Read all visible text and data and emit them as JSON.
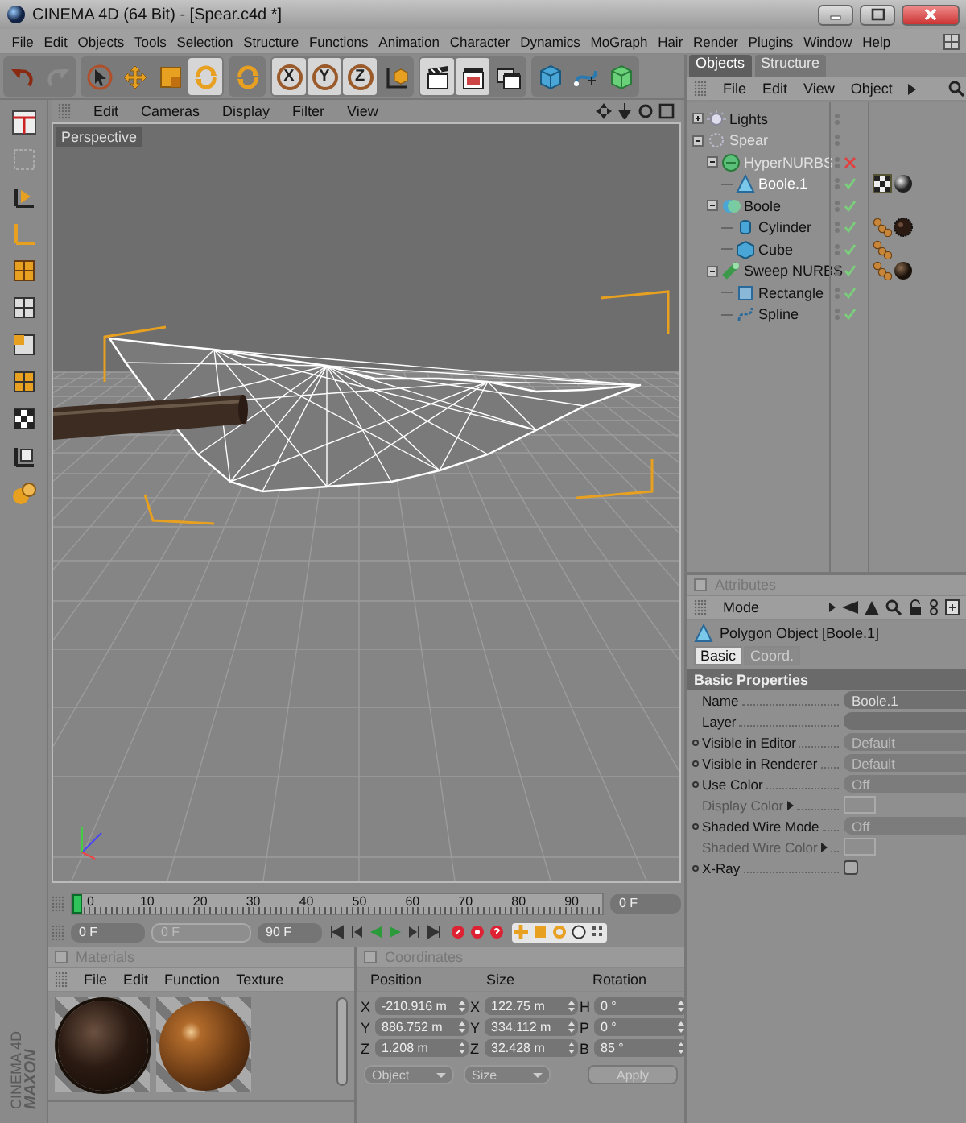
{
  "window": {
    "title": "CINEMA 4D (64 Bit) - [Spear.c4d *]"
  },
  "menu": [
    "File",
    "Edit",
    "Objects",
    "Tools",
    "Selection",
    "Structure",
    "Functions",
    "Animation",
    "Character",
    "Dynamics",
    "MoGraph",
    "Hair",
    "Render",
    "Plugins",
    "Window",
    "Help"
  ],
  "toolbar": [
    [
      {
        "kind": "undo",
        "selected": false,
        "disabled": false
      },
      {
        "kind": "redo",
        "selected": false,
        "disabled": true
      }
    ],
    [
      {
        "kind": "select",
        "selected": false,
        "disabled": false
      },
      {
        "kind": "move",
        "selected": false,
        "disabled": false
      },
      {
        "kind": "scale",
        "selected": false,
        "disabled": false
      },
      {
        "kind": "rotate",
        "selected": true,
        "disabled": false
      }
    ],
    [
      {
        "kind": "recent",
        "selected": false,
        "disabled": false
      }
    ],
    [
      {
        "kind": "axis",
        "label": "X",
        "selected": true,
        "disabled": false
      },
      {
        "kind": "axis",
        "label": "Y",
        "selected": true,
        "disabled": false
      },
      {
        "kind": "axis",
        "label": "Z",
        "selected": true,
        "disabled": false
      },
      {
        "kind": "coords",
        "selected": false,
        "disabled": false
      }
    ],
    [
      {
        "kind": "render-view",
        "selected": true,
        "disabled": false
      },
      {
        "kind": "render-picture",
        "selected": true,
        "disabled": false
      },
      {
        "kind": "render-settings",
        "selected": false,
        "disabled": false
      }
    ],
    [
      {
        "kind": "cube",
        "selected": false,
        "disabled": false
      },
      {
        "kind": "spline",
        "selected": false,
        "disabled": false
      },
      {
        "kind": "nurbs",
        "selected": false,
        "disabled": false
      }
    ]
  ],
  "viewport": {
    "menu": [
      "Edit",
      "Cameras",
      "Display",
      "Filter",
      "View"
    ],
    "camera": "Perspective"
  },
  "timeline": {
    "ticks": [
      "0",
      "10",
      "20",
      "30",
      "40",
      "50",
      "60",
      "70",
      "80",
      "90"
    ],
    "playhead": {
      "level": 0
    },
    "current_frame": "0 F",
    "start": "0 F",
    "preview": "0 F",
    "preview_disabled": true,
    "end": "90 F"
  },
  "materials": {
    "title": "Materials",
    "pinned": false,
    "menu": [
      "File",
      "Edit",
      "Function",
      "Texture"
    ],
    "swatches": [
      {
        "kind": "rough"
      },
      {
        "kind": "glossy"
      }
    ]
  },
  "coordinates": {
    "title": "Coordinates",
    "pinned": false,
    "columns": [
      "Position",
      "Size",
      "Rotation"
    ],
    "rows": [
      {
        "cells": [
          {
            "axis": "X",
            "value": "-210.916 m"
          },
          {
            "axis": "X",
            "value": "122.75 m"
          },
          {
            "axis": "H",
            "value": "0 °"
          }
        ]
      },
      {
        "cells": [
          {
            "axis": "Y",
            "value": "886.752 m"
          },
          {
            "axis": "Y",
            "value": "334.112 m"
          },
          {
            "axis": "P",
            "value": "0 °"
          }
        ]
      },
      {
        "cells": [
          {
            "axis": "Z",
            "value": "1.208 m"
          },
          {
            "axis": "Z",
            "value": "32.428 m"
          },
          {
            "axis": "B",
            "value": "85 °"
          }
        ]
      }
    ],
    "mode": "Object",
    "size_mode": "Size",
    "apply": "Apply"
  },
  "logo": {
    "brand": "MAXON",
    "product": "CINEMA 4D"
  },
  "objects": {
    "tabs": [
      {
        "label": "Objects",
        "selected": true
      },
      {
        "label": "Structure",
        "selected": false
      }
    ],
    "menu": [
      "File",
      "Edit",
      "View",
      "Object"
    ],
    "tree": [
      {
        "name": "Lights",
        "kind": "light",
        "expanded": false,
        "selected": false,
        "dimmed": false
      },
      {
        "name": "Spear",
        "kind": "null",
        "expanded": true,
        "selected": false,
        "dimmed": true,
        "children": [
          {
            "name": "HyperNURBS",
            "kind": "hypernurbs",
            "expanded": true,
            "selected": false,
            "dimmed": true,
            "enabled": false,
            "children": [
              {
                "name": "Boole.1",
                "kind": "polygon",
                "selected": true,
                "dimmed": false,
                "enabled": true,
                "tags": [
                  {
                    "kind": "texture"
                  },
                  {
                    "kind": "material-grey"
                  }
                ]
              }
            ]
          },
          {
            "name": "Boole",
            "kind": "boole",
            "expanded": true,
            "selected": false,
            "dimmed": false,
            "enabled": true,
            "children": [
              {
                "name": "Cylinder",
                "kind": "cylinder",
                "selected": false,
                "dimmed": false,
                "enabled": true,
                "tags": [
                  {
                    "kind": "texture-coords"
                  },
                  {
                    "kind": "material-rough"
                  }
                ]
              },
              {
                "name": "Cube",
                "kind": "cube",
                "selected": false,
                "dimmed": false,
                "enabled": true,
                "tags": [
                  {
                    "kind": "texture-coords"
                  }
                ]
              }
            ]
          },
          {
            "name": "Sweep NURBS",
            "kind": "sweep",
            "expanded": true,
            "selected": false,
            "dimmed": false,
            "enabled": true,
            "tags": [
              {
                "kind": "texture-coords"
              },
              {
                "kind": "material-dark"
              }
            ],
            "children": [
              {
                "name": "Rectangle",
                "kind": "rectangle",
                "selected": false,
                "dimmed": false,
                "enabled": true
              },
              {
                "name": "Spline",
                "kind": "spline",
                "selected": false,
                "dimmed": false,
                "enabled": true
              }
            ]
          }
        ]
      }
    ]
  },
  "attributes": {
    "title": "Attributes",
    "pinned": false,
    "mode": "Mode",
    "object": "Polygon Object [Boole.1]",
    "tabs": [
      {
        "label": "Basic",
        "selected": true
      },
      {
        "label": "Coord.",
        "selected": false
      }
    ],
    "section": "Basic Properties",
    "fields": [
      {
        "label": "Name",
        "kind": "text",
        "value": "Boole.1",
        "animatable": false,
        "disabled": false
      },
      {
        "label": "Layer",
        "kind": "text",
        "animatable": false,
        "disabled": false
      },
      {
        "label": "Visible in Editor",
        "kind": "dropdown",
        "value": "Default",
        "animatable": true,
        "disabled": false
      },
      {
        "label": "Visible in Renderer",
        "kind": "dropdown",
        "value": "Default",
        "animatable": true,
        "disabled": false
      },
      {
        "label": "Use Color",
        "kind": "dropdown",
        "value": "Off",
        "animatable": true,
        "disabled": false
      },
      {
        "label": "Display Color",
        "kind": "color",
        "animatable": false,
        "disabled": true
      },
      {
        "label": "Shaded Wire Mode",
        "kind": "dropdown",
        "value": "Off",
        "animatable": true,
        "disabled": false
      },
      {
        "label": "Shaded Wire Color",
        "kind": "color",
        "animatable": false,
        "disabled": true
      },
      {
        "label": "X-Ray",
        "kind": "checkbox",
        "checked": false,
        "animatable": true,
        "disabled": false
      }
    ]
  }
}
